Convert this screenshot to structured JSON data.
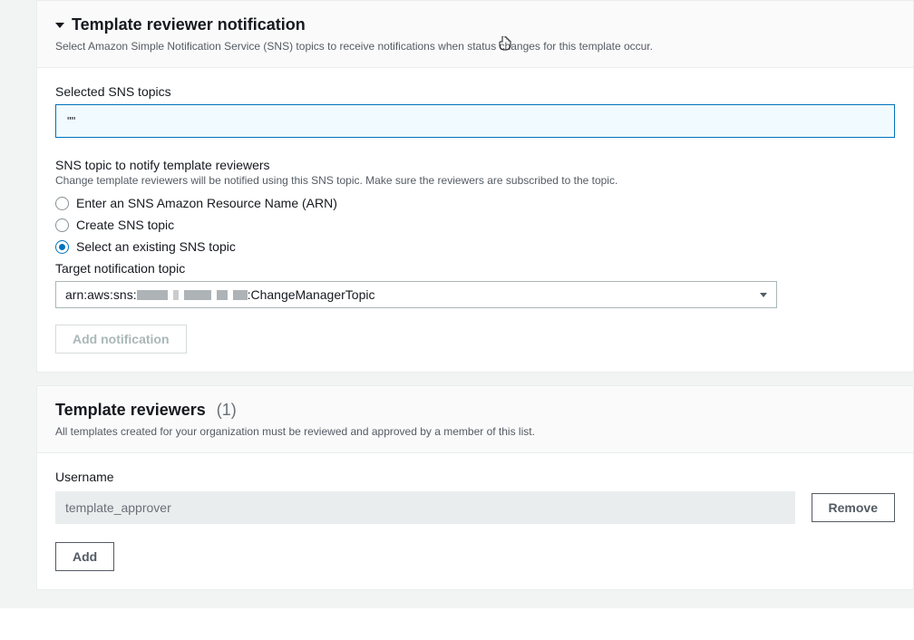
{
  "notification": {
    "title": "Template reviewer notification",
    "desc": "Select Amazon Simple Notification Service (SNS) topics to receive notifications when status changes for this template occur.",
    "selected_label": "Selected SNS topics",
    "selected_value": "\"\"",
    "sns_title": "SNS topic to notify template reviewers",
    "sns_desc": "Change template reviewers will be notified using this SNS topic. Make sure the reviewers are subscribed to the topic.",
    "options": {
      "enter_arn": "Enter an SNS Amazon Resource Name (ARN)",
      "create_topic": "Create SNS topic",
      "select_existing": "Select an existing SNS topic"
    },
    "target_label": "Target notification topic",
    "target_value_prefix": "arn:aws:sns:",
    "target_value_suffix": ":ChangeManagerTopic",
    "add_notification_btn": "Add notification"
  },
  "reviewers": {
    "title": "Template reviewers",
    "count": "(1)",
    "desc": "All templates created for your organization must be reviewed and approved by a member of this list.",
    "username_label": "Username",
    "username_value": "template_approver",
    "remove_btn": "Remove",
    "add_btn": "Add"
  }
}
